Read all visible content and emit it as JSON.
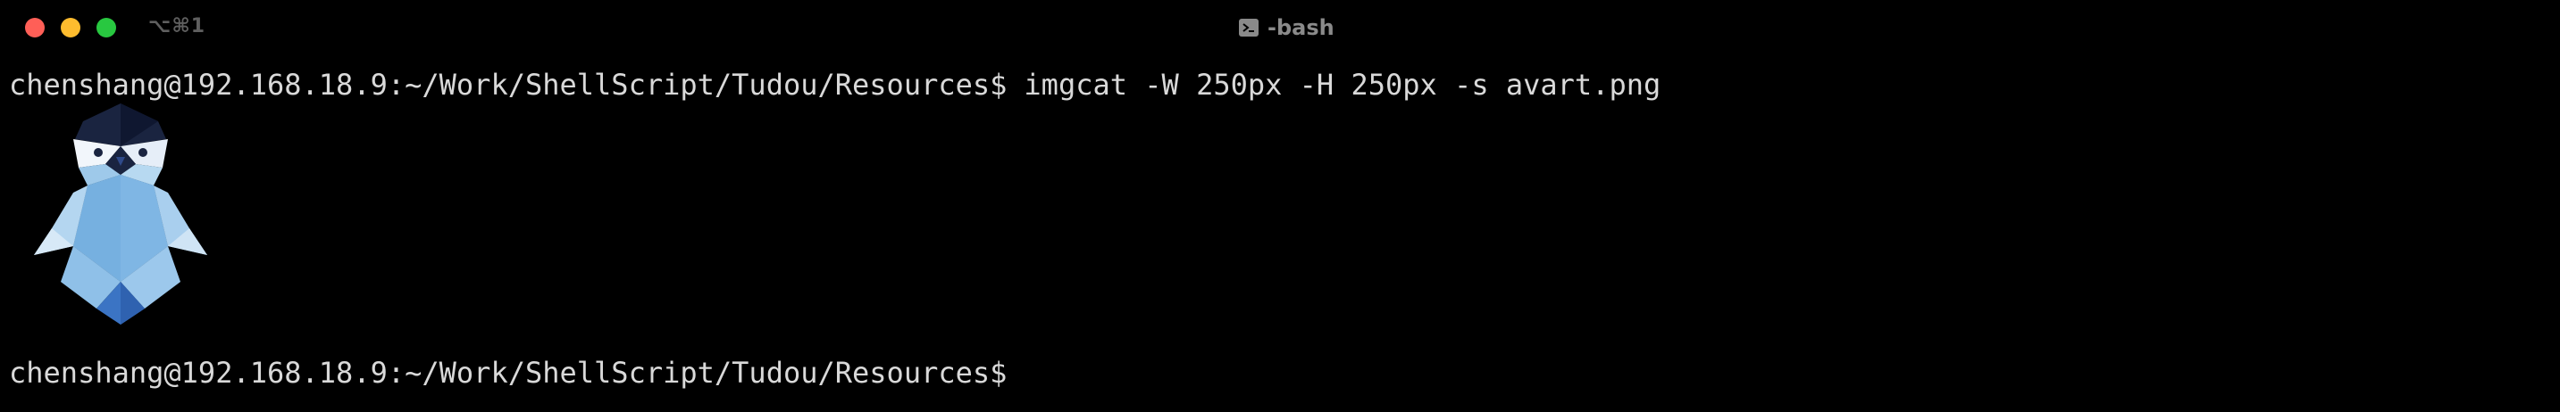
{
  "window": {
    "shortcut": "⌥⌘1",
    "title": "-bash",
    "title_icon": "terminal-icon"
  },
  "terminal": {
    "lines": [
      {
        "prompt": "chenshang@192.168.18.9:~/Work/ShellScript/Tudou/Resources$",
        "command": "imgcat -W 250px -H 250px -s avart.png"
      },
      {
        "prompt": "chenshang@192.168.18.9:~/Work/ShellScript/Tudou/Resources$",
        "command": ""
      }
    ],
    "image": "penguin-avatar"
  },
  "colors": {
    "background": "#000000",
    "text": "#d9d9d9",
    "close": "#ff5f57",
    "minimize": "#febc2e",
    "zoom": "#28c840"
  }
}
